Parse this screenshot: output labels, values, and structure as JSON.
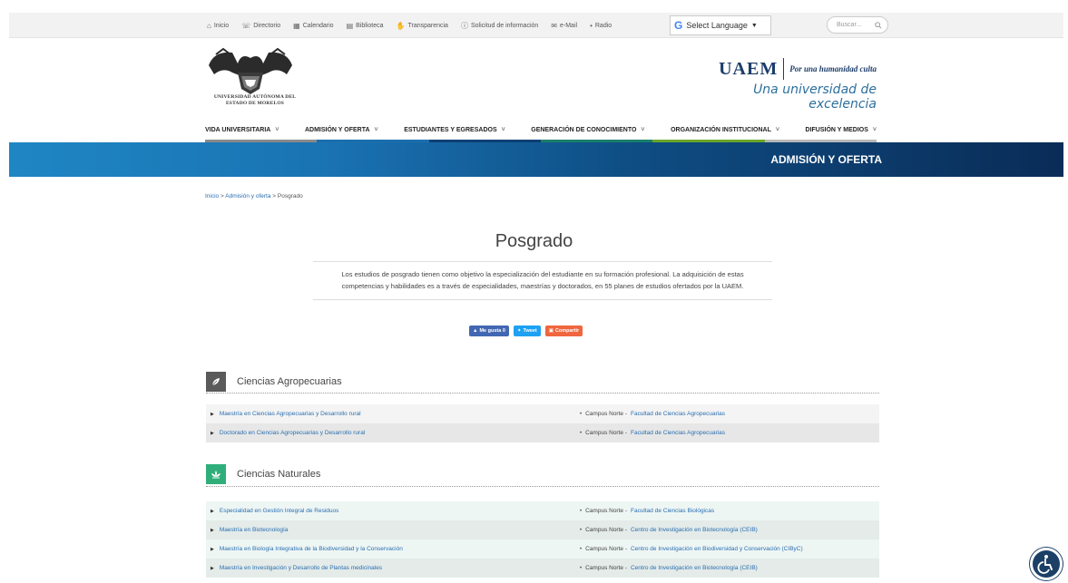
{
  "topbar": {
    "items": [
      {
        "label": "Inicio",
        "icon": "home-icon",
        "glyph": "⌂"
      },
      {
        "label": "Directorio",
        "icon": "phone-icon",
        "glyph": "☏"
      },
      {
        "label": "Calendario",
        "icon": "calendar-icon",
        "glyph": "▦"
      },
      {
        "label": "Biblioteca",
        "icon": "book-icon",
        "glyph": "▤"
      },
      {
        "label": "Transparencia",
        "icon": "handshake-icon",
        "glyph": "✋"
      },
      {
        "label": "Solicitud de información",
        "icon": "info-icon",
        "glyph": "ⓘ"
      },
      {
        "label": "e-Mail",
        "icon": "envelope-icon",
        "glyph": "✉"
      },
      {
        "label": "Radio",
        "icon": "microphone-icon",
        "glyph": "•"
      }
    ],
    "translate_label": "Select Language",
    "translate_caret": "▼",
    "translate_g": "G",
    "search_placeholder": "Buscar..."
  },
  "header": {
    "university_name": "Universidad Autónoma del Estado de Morelos",
    "brand": "UAEM",
    "motto": "Por una humanidad culta",
    "tagline": "Una universidad de excelencia"
  },
  "mainnav": {
    "items": [
      {
        "label": "VIDA UNIVERSITARIA"
      },
      {
        "label": "ADMISIÓN Y OFERTA"
      },
      {
        "label": "ESTUDIANTES Y EGRESADOS"
      },
      {
        "label": "GENERACIÓN DE CONOCIMIENTO"
      },
      {
        "label": "ORGANIZACIÓN INSTITUCIONAL"
      },
      {
        "label": "DIFUSIÓN Y MEDIOS"
      }
    ],
    "line_colors": [
      "#8a8a8a",
      "#1b6fae",
      "#0e3f74",
      "#1a7f6b",
      "#6aa62a",
      "#b8b8b8"
    ]
  },
  "banner": {
    "title": "ADMISIÓN Y OFERTA"
  },
  "breadcrumb": {
    "home": "Inicio",
    "section": "Admisión y oferta",
    "current": "Posgrado",
    "sep": ">"
  },
  "page": {
    "title": "Posgrado",
    "intro": "Los estudios de posgrado tienen como objetivo la especialización del estudiante en su formación profesional. La adquisición de estas competencias y habilidades es a través de especialidades, maestrías y doctorados, en 55 planes de estudios ofertados por la UAEM."
  },
  "social": {
    "like": "Me gusta 0",
    "tweet": "Tweet",
    "share": "Compartir"
  },
  "sections": {
    "agro": {
      "title": "Ciencias Agropecuarias",
      "icon": "leaf-icon",
      "color": "#5a5a5a",
      "rows": [
        {
          "program": "Maestría en Ciencias Agropecuarias y Desarrollo rural",
          "campus": "Campus Norte -",
          "facility": "Facultad de Ciencias Agropecuarias"
        },
        {
          "program": "Doctorado en Ciencias Agropecuarias y Desarrollo rural",
          "campus": "Campus Norte -",
          "facility": "Facultad de Ciencias Agropecuarias"
        }
      ]
    },
    "nat": {
      "title": "Ciencias Naturales",
      "icon": "lotus-icon",
      "color": "#2fae7a",
      "rows": [
        {
          "program": "Especialidad en Gestión Integral de Residuos",
          "campus": "Campus Norte -",
          "facility": "Facultad de Ciencias Biológicas"
        },
        {
          "program": "Maestría en Biotecnología",
          "campus": "Campus Norte -",
          "facility": "Centro de Investigación en Biotecnología (CEIB)"
        },
        {
          "program": "Maestría en Biología Integrativa de la Biodiversidad y la Conservación",
          "campus": "Campus Norte -",
          "facility": "Centro de Investigación en Biodiversidad y Conservación (CIByC)"
        },
        {
          "program": "Maestría en Investigación y Desarrollo de Plantas medicinales",
          "campus": "Campus Norte -",
          "facility": "Centro de Investigación en Biotecnología (CEIB)"
        }
      ]
    }
  }
}
